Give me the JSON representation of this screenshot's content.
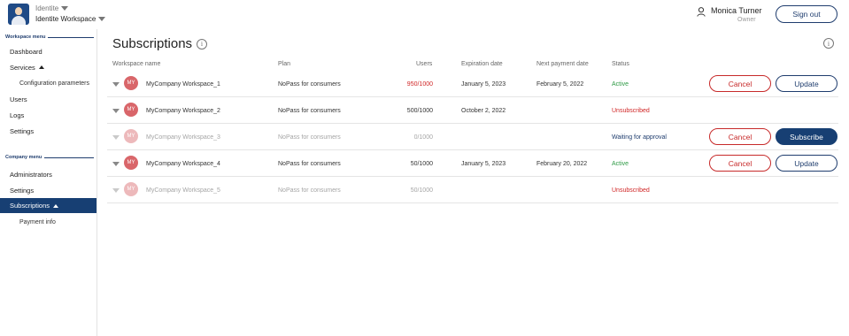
{
  "header": {
    "app_name": "Identite",
    "workspace_name": "Identite Workspace",
    "user_name": "Monica Turner",
    "user_role": "Owner",
    "sign_out_label": "Sign out"
  },
  "sidebar": {
    "workspace_menu_label": "Workspace menu",
    "workspace_items": [
      {
        "label": "Dashboard"
      },
      {
        "label": "Services"
      },
      {
        "label": "Configuration parameters"
      },
      {
        "label": "Users"
      },
      {
        "label": "Logs"
      },
      {
        "label": "Settings"
      }
    ],
    "company_menu_label": "Company menu",
    "company_items": [
      {
        "label": "Administrators"
      },
      {
        "label": "Settings"
      },
      {
        "label": "Subscriptions"
      },
      {
        "label": "Payment info"
      }
    ]
  },
  "main": {
    "title": "Subscriptions",
    "info_glyph": "i",
    "columns": [
      "Workspace name",
      "Plan",
      "Users",
      "Expiration date",
      "Next payment date",
      "Status"
    ],
    "rows": [
      {
        "avatar": "MY",
        "workspace": "MyCompany Workspace_1",
        "plan": "NoPass for consumers",
        "users": "950/1000",
        "expiration": "January 5, 2023",
        "next_payment": "February 5, 2022",
        "status": "Active",
        "cancel_label": "Cancel",
        "action_label": "Update"
      },
      {
        "avatar": "MY",
        "workspace": "MyCompany Workspace_2",
        "plan": "NoPass for consumers",
        "users": "500/1000",
        "expiration": "October 2, 2022",
        "next_payment": "",
        "status": "Unsubscribed"
      },
      {
        "avatar": "MY",
        "workspace": "MyCompany Workspace_3",
        "plan": "NoPass for consumers",
        "users": "0/1000",
        "expiration": "",
        "next_payment": "",
        "status": "Waiting for approval",
        "cancel_label": "Cancel",
        "action_label": "Subscribe"
      },
      {
        "avatar": "MY",
        "workspace": "MyCompany Workspace_4",
        "plan": "NoPass for consumers",
        "users": "50/1000",
        "expiration": "January 5, 2023",
        "next_payment": "February 20, 2022",
        "status": "Active",
        "cancel_label": "Cancel",
        "action_label": "Update"
      },
      {
        "avatar": "MY",
        "workspace": "MyCompany Workspace_5",
        "plan": "NoPass for consumers",
        "users": "50/1000",
        "expiration": "",
        "next_payment": "",
        "status": "Unsubscribed"
      }
    ]
  },
  "colors": {
    "brand_navy": "#173f73",
    "cancel_red": "#c72a2a",
    "active_green": "#2e9a45",
    "avatar_red": "#d9666a"
  }
}
